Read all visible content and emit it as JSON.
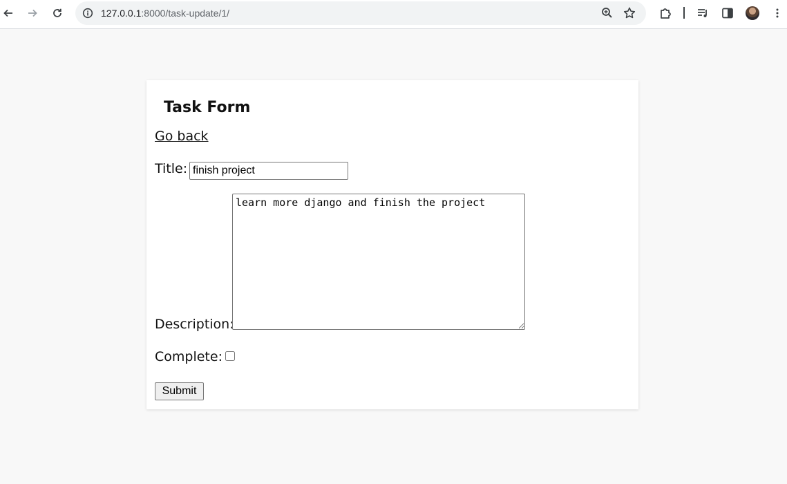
{
  "browser": {
    "url_host": "127.0.0.1",
    "url_path": ":8000/task-update/1/"
  },
  "page": {
    "title": "Task Form",
    "back_link": "Go back"
  },
  "form": {
    "title_label": "Title:",
    "title_value": "finish project",
    "description_label": "Description:",
    "description_value": "learn more django and finish the project",
    "complete_label": "Complete:",
    "complete_checked": false,
    "submit_label": "Submit"
  },
  "icons": {
    "back": "arrow-left-icon",
    "forward": "arrow-right-icon",
    "reload": "reload-icon",
    "site_info": "info-icon",
    "zoom": "zoom-icon",
    "bookmark": "star-icon",
    "extensions": "puzzle-icon",
    "media": "media-control-icon",
    "side_panel": "side-panel-icon",
    "menu": "kebab-menu-icon"
  }
}
